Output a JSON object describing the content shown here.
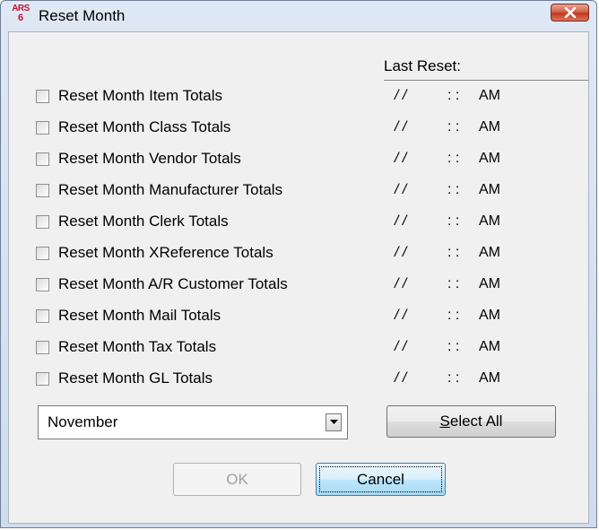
{
  "window": {
    "title": "Reset Month",
    "icon_name": "ars-app-icon",
    "icon_text_top": "ARS",
    "icon_text_bottom": "6"
  },
  "last_reset_header": "Last Reset:",
  "options": [
    {
      "label": "Reset Month Item Totals",
      "checked": false,
      "date": "/ /",
      "time": ": :",
      "ampm": "AM"
    },
    {
      "label": "Reset Month Class Totals",
      "checked": false,
      "date": "/ /",
      "time": ": :",
      "ampm": "AM"
    },
    {
      "label": "Reset Month Vendor Totals",
      "checked": false,
      "date": "/ /",
      "time": ": :",
      "ampm": "AM"
    },
    {
      "label": "Reset Month Manufacturer Totals",
      "checked": false,
      "date": "/ /",
      "time": ": :",
      "ampm": "AM"
    },
    {
      "label": "Reset Month Clerk Totals",
      "checked": false,
      "date": "/ /",
      "time": ": :",
      "ampm": "AM"
    },
    {
      "label": "Reset Month XReference Totals",
      "checked": false,
      "date": "/ /",
      "time": ": :",
      "ampm": "AM"
    },
    {
      "label": "Reset Month A/R Customer Totals",
      "checked": false,
      "date": "/ /",
      "time": ": :",
      "ampm": "AM"
    },
    {
      "label": "Reset Month Mail Totals",
      "checked": false,
      "date": "/ /",
      "time": ": :",
      "ampm": "AM"
    },
    {
      "label": "Reset Month Tax Totals",
      "checked": false,
      "date": "/ /",
      "time": ": :",
      "ampm": "AM"
    },
    {
      "label": "Reset Month GL Totals",
      "checked": false,
      "date": "/ /",
      "time": ": :",
      "ampm": "AM"
    }
  ],
  "month_select": {
    "value": "November"
  },
  "buttons": {
    "select_all_mnemonic": "S",
    "select_all_rest": "elect All",
    "ok": "OK",
    "ok_enabled": false,
    "cancel": "Cancel"
  },
  "colors": {
    "close_button": "#c0391e",
    "icon_red": "#c8102e",
    "disabled_text": "#a0a0a0"
  }
}
